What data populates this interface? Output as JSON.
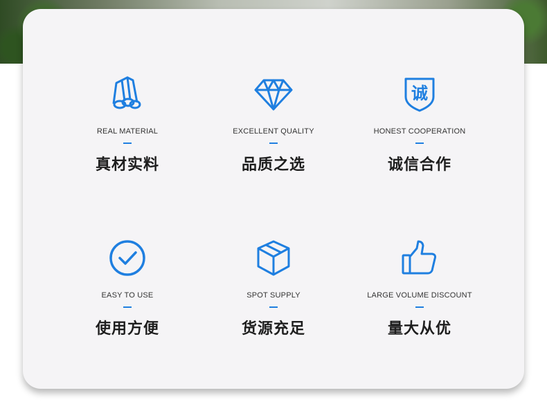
{
  "accent_color": "#1f7fe0",
  "features": [
    {
      "icon": "pipes-icon",
      "en": "REAL MATERIAL",
      "cn": "真材实料"
    },
    {
      "icon": "diamond-icon",
      "en": "EXCELLENT QUALITY",
      "cn": "品质之选"
    },
    {
      "icon": "shield-badge-icon",
      "badge_char": "诚",
      "en": "HONEST COOPERATION",
      "cn": "诚信合作"
    },
    {
      "icon": "check-circle-icon",
      "en": "EASY TO USE",
      "cn": "使用方便"
    },
    {
      "icon": "box-icon",
      "en": "SPOT SUPPLY",
      "cn": "货源充足"
    },
    {
      "icon": "thumbs-up-icon",
      "en": "LARGE VOLUME DISCOUNT",
      "cn": "量大从优"
    }
  ]
}
